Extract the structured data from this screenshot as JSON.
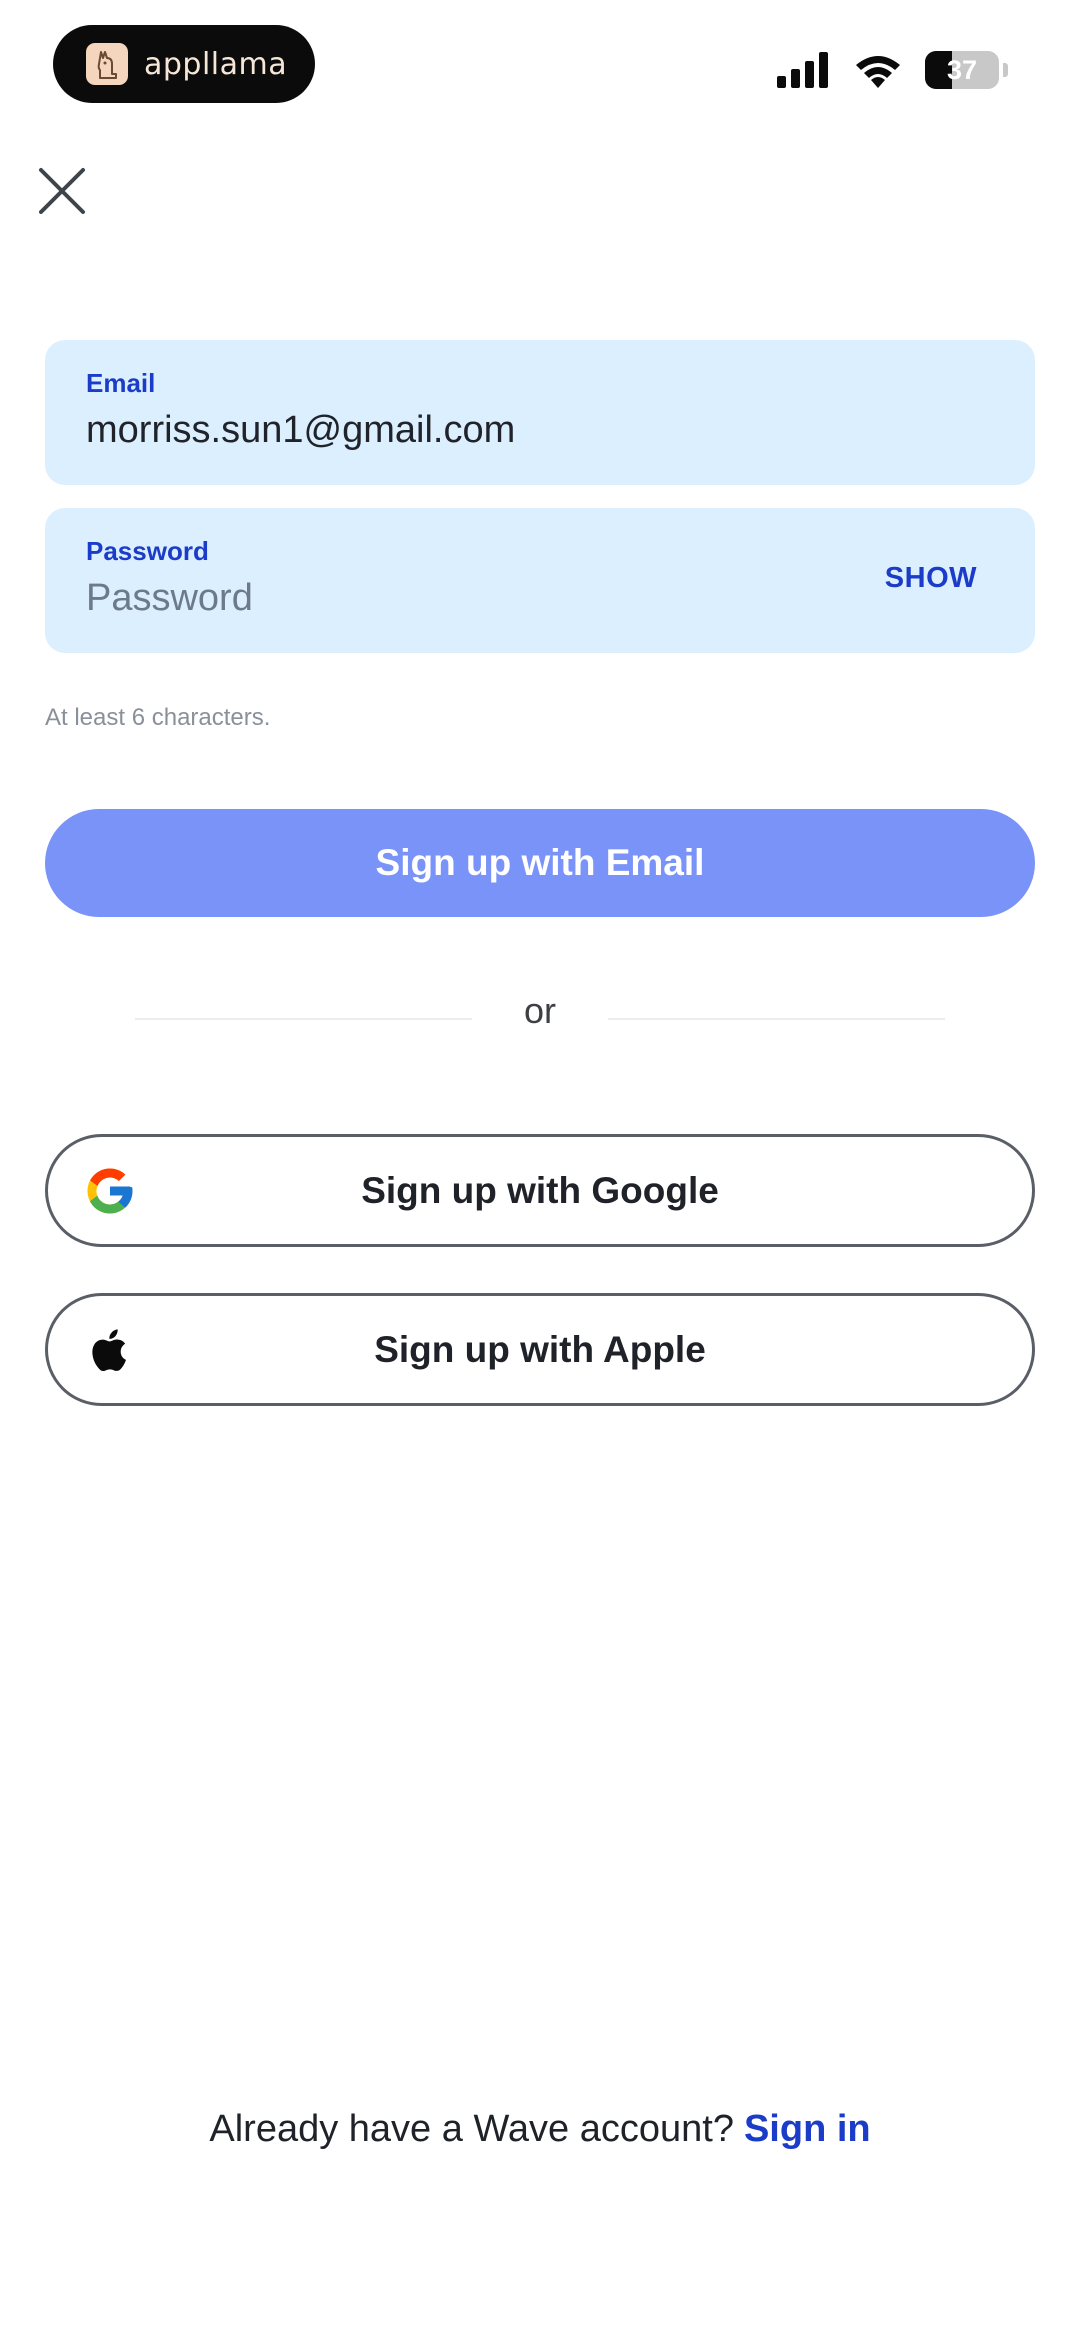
{
  "status_bar": {
    "app_badge_text": "appllama",
    "battery_level": "37",
    "battery_fraction": 0.37,
    "icons": [
      "cellular-signal-icon",
      "wifi-icon",
      "battery-icon"
    ]
  },
  "header": {
    "close_icon": "close-icon"
  },
  "form": {
    "email": {
      "label": "Email",
      "value": "morriss.sun1@gmail.com"
    },
    "password": {
      "label": "Password",
      "placeholder": "Password",
      "value": "",
      "toggle_label": "SHOW"
    },
    "hint": "At least 6 characters."
  },
  "actions": {
    "primary_label": "Sign up with Email",
    "primary_color": "#7a93f8",
    "divider_text": "or",
    "google_label": "Sign up with Google",
    "apple_label": "Sign up with Apple"
  },
  "footer": {
    "prompt": "Already have a Wave account?",
    "link_label": "Sign in"
  },
  "colors": {
    "accent": "#1a3cc8",
    "field_bg": "#dcefff"
  }
}
